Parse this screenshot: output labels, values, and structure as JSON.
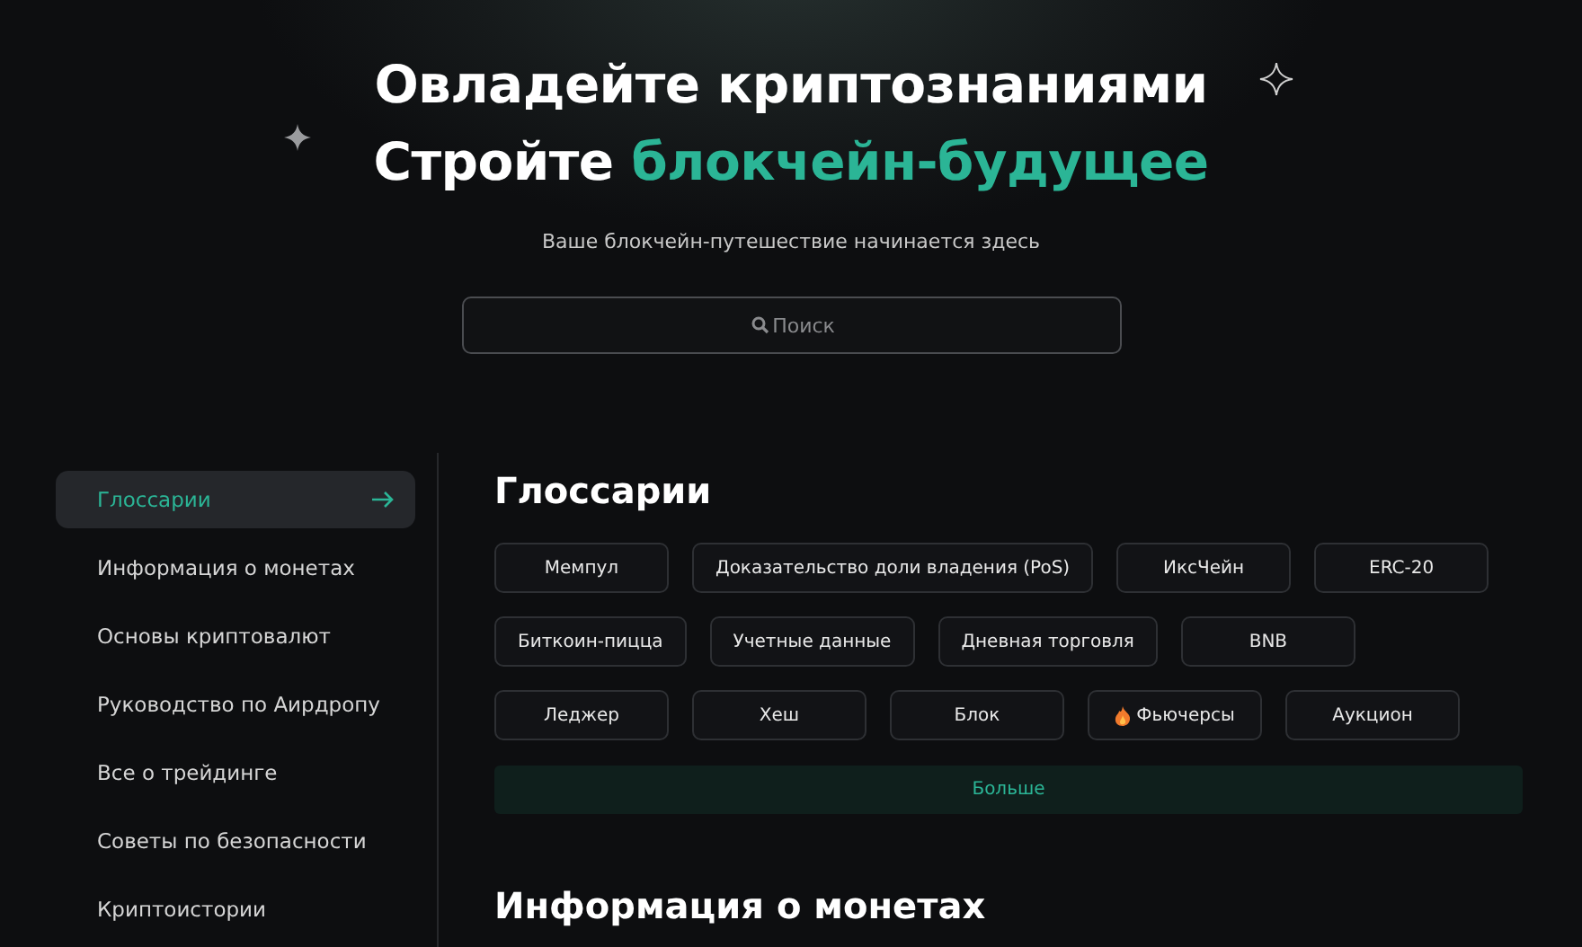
{
  "hero": {
    "title_line1": "Овладейте криптознаниями",
    "title_line2": "Стройте",
    "title_accent": "блокчейн-будущее",
    "subtitle": "Ваше блокчейн-путешествие начинается здесь"
  },
  "search": {
    "placeholder": "Поиск"
  },
  "sidebar": {
    "items": [
      {
        "label": "Глоссарии",
        "selected": true
      },
      {
        "label": "Информация о монетах",
        "selected": false
      },
      {
        "label": "Основы криптовалют",
        "selected": false
      },
      {
        "label": "Руководство по Аирдропу",
        "selected": false
      },
      {
        "label": "Все о трейдинге",
        "selected": false
      },
      {
        "label": "Советы по безопасности",
        "selected": false
      },
      {
        "label": "Криптоистории",
        "selected": false
      }
    ]
  },
  "glossary": {
    "heading": "Глоссарии",
    "tags": [
      {
        "label": "Мемпул",
        "kind": "plain"
      },
      {
        "label": "Доказательство доли владения (PoS)",
        "kind": "plain"
      },
      {
        "label": "ИксЧейн",
        "kind": "plain"
      },
      {
        "label": "ERC-20",
        "kind": "plain"
      },
      {
        "label": "Биткоин-пицца",
        "kind": "plain"
      },
      {
        "label": "Учетные данные",
        "kind": "plain"
      },
      {
        "label": "Дневная торговля",
        "kind": "plain"
      },
      {
        "label": "BNB",
        "kind": "plain"
      },
      {
        "label": "Леджер",
        "kind": "plain"
      },
      {
        "label": "Хеш",
        "kind": "plain"
      },
      {
        "label": "Блок",
        "kind": "plain"
      },
      {
        "label": "Фьючерсы",
        "kind": "hot"
      },
      {
        "label": "Аукцион",
        "kind": "plain"
      }
    ],
    "more": "Больше"
  },
  "next_section": {
    "heading": "Информация о монетах"
  }
}
